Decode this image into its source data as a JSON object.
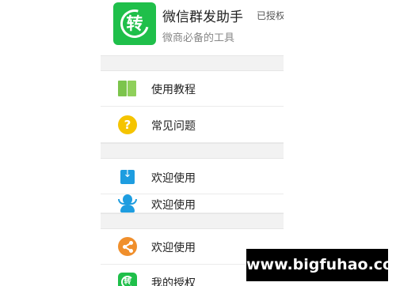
{
  "app": {
    "icon_name": "transfer-icon",
    "icon_glyph": "转",
    "title": "微信群发助手",
    "status": "已授权",
    "subtitle": "微商必备的工具"
  },
  "menu": [
    {
      "icon": "book-icon",
      "label": "使用教程"
    },
    {
      "icon": "help-icon",
      "glyph": "?",
      "label": "常见问题"
    },
    {
      "icon": "download-icon",
      "glyph": "↓",
      "label": "欢迎使用"
    },
    {
      "icon": "user-icon",
      "label": "欢迎使用"
    },
    {
      "icon": "share-icon",
      "label": "欢迎使用"
    },
    {
      "icon": "auth-icon",
      "glyph": "转",
      "label": "我的授权"
    }
  ],
  "watermark": "www.bigfuhao.com",
  "colors": {
    "green": "#1fbf4a",
    "yellow": "#f5c400",
    "blue": "#1e9de0",
    "orange": "#f08f2c"
  }
}
